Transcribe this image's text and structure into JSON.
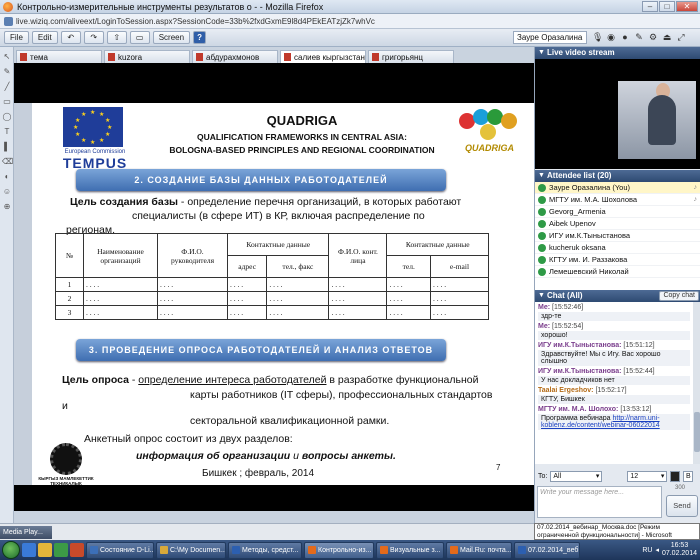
{
  "window": {
    "title": "Контрольно-измерительные инструменты результатов о - - Mozilla Firefox",
    "url": "live.wiziq.com/aliveext/LoginToSession.aspx?SessionCode=33b%2fxdGxmE9l8d4PEkEATzjZk7whVc"
  },
  "toolbar": {
    "file_label": "File",
    "edit_label": "Edit",
    "screen_label": "Screen",
    "help_label": "?",
    "user_name": "Зауре Оразалина"
  },
  "tabs": [
    {
      "label": "тема"
    },
    {
      "label": "kuzora"
    },
    {
      "label": "абдурахмонов"
    },
    {
      "label": "салиев кыргызстан",
      "close": "×"
    },
    {
      "label": "григорьянц"
    }
  ],
  "slide": {
    "eu_caption": "European Commission",
    "tempus": "TEMPUS",
    "title1": "QUADRIGA",
    "title2": "QUALIFICATION  FRAMEWORKS IN  CENTRAL ASIA:",
    "title3": "BOLOGNA-BASED  PRINCIPLES  AND  REGIONAL  COORDINATION",
    "logo_text": "QUADRIGA",
    "banner1": "2. СОЗДАНИЕ БАЗЫ ДАННЫХ РАБОТОДАТЕЛЕЙ",
    "goal_label": "Цель создания базы",
    "goal_text1": " - определение перечня организаций, в которых работают",
    "goal_text2": "специалисты (в сфере ИТ) в КР, включая распределение по",
    "goal_text3": "регионам.",
    "table": {
      "h_num": "№",
      "h_org": "Наименование организаций",
      "h_fio": "Ф.И.О. руководителя",
      "h_contacts": "Контактные данные",
      "h_addr": "адрес",
      "h_phone": "тел., факс",
      "h_fio2": "Ф.И.О. конт. лица",
      "h_contacts2": "Контактные данные",
      "h_tel": "тел.",
      "h_email": "e-mail",
      "rows": [
        {
          "n": "1",
          "dots": ". . . ."
        },
        {
          "n": "2",
          "dots": ". . . ."
        },
        {
          "n": "3",
          "dots": ". . . ."
        }
      ]
    },
    "banner2": "3. ПРОВЕДЕНИЕ ОПРОСА РАБОТОДАТЕЛЕЙ И АНАЛИЗ ОТВЕТОВ",
    "survey_label": "Цель опроса",
    "survey_text1": "определение интереса работодателей",
    "survey_text2": " в разработке функциональной",
    "survey_text3": "карты работников (IT сферы), профессиональных стандартов",
    "survey_and": "и",
    "survey_text4": "секторальной квалификационной рамки.",
    "survey_text5": "Анкетный опрос состоит из двух разделов:",
    "survey_text6a": "информация об организации",
    "survey_text6b": " и ",
    "survey_text6c": "вопросы анкеты.",
    "footer": "Бишкек ;  февраль,  2014",
    "page": "7",
    "kg_logo": "КЫРГЫЗ МАМЛЕКЕТТИК ТЕХНИКАЛЫК УНИВЕРСИТЕТИ"
  },
  "right_panel": {
    "video_title": "Live video stream",
    "attendee_title": "Attendee list (20)",
    "attendees": [
      {
        "name": "Зауре Оразалина (You)",
        "me": true
      },
      {
        "name": "МГТУ им. М.А. Шохолова",
        "me": false
      },
      {
        "name": "Gevorg_Armenia",
        "me": false
      },
      {
        "name": "Aibek Upenov",
        "me": false
      },
      {
        "name": "ИГУ им.К.Тыныстанова",
        "me": false
      },
      {
        "name": "kucheruk oksana",
        "me": false
      },
      {
        "name": "КГТУ им. И. Раззакова",
        "me": false
      },
      {
        "name": "Лемешевский Николай",
        "me": false
      }
    ],
    "chat_title": "Chat (All)",
    "copy_chat": "Copy chat",
    "messages": [
      {
        "who": "Me:",
        "time": "[15:52:46]",
        "text": "здр-те"
      },
      {
        "who": "Me:",
        "time": "[15:52:54]",
        "text": "хорошо!"
      },
      {
        "who": "ИГУ им.К.Тыныстанова:",
        "time": "[15:51:12]",
        "text": "Здравствуйте! Мы с Игу. Вас хорошо слышно"
      },
      {
        "who": "ИГУ им.К.Тыныстанова:",
        "time": "[15:52:44]",
        "text": "У нас докладчиков нет"
      },
      {
        "who": "Taalai Ergeshov:",
        "time": "[15:52:17]",
        "text": "КГТУ, Бишкек"
      },
      {
        "who": "МГТУ им. М.А. Шолохо:",
        "time": "[13:53:12]",
        "text": "Программа вебинара ",
        "link": "http://narm.uni-koblenz.de/content/webinar-06022014"
      }
    ],
    "to_label": "To:",
    "to_value": "All",
    "font_size": "12",
    "message_placeholder": "Write your message here...",
    "char_count": "300",
    "send_label": "Send"
  },
  "status": {
    "media_player": "Media Play...",
    "tooltip": "07.02.2014_вебинар_Москва.doc [Режим ограниченной функциональности] - Microsoft"
  },
  "taskbar": {
    "tasks": [
      {
        "label": "Состояние D-Li...",
        "color": "#3c6fb8"
      },
      {
        "label": "C:\\My Documen...",
        "color": "#d8a93a"
      },
      {
        "label": "Методы, средст...",
        "color": "#2c5fb0"
      },
      {
        "label": "Контрольно-из...",
        "color": "#e46a1b"
      },
      {
        "label": "Визуальные з...",
        "color": "#e46a1b"
      },
      {
        "label": "Mail.Ru: почта...",
        "color": "#e46a1b"
      },
      {
        "label": "07.02.2014_веб...",
        "color": "#2c5fb0"
      }
    ],
    "lang": "RU",
    "time": "16:53",
    "date": "07.02.2014"
  }
}
